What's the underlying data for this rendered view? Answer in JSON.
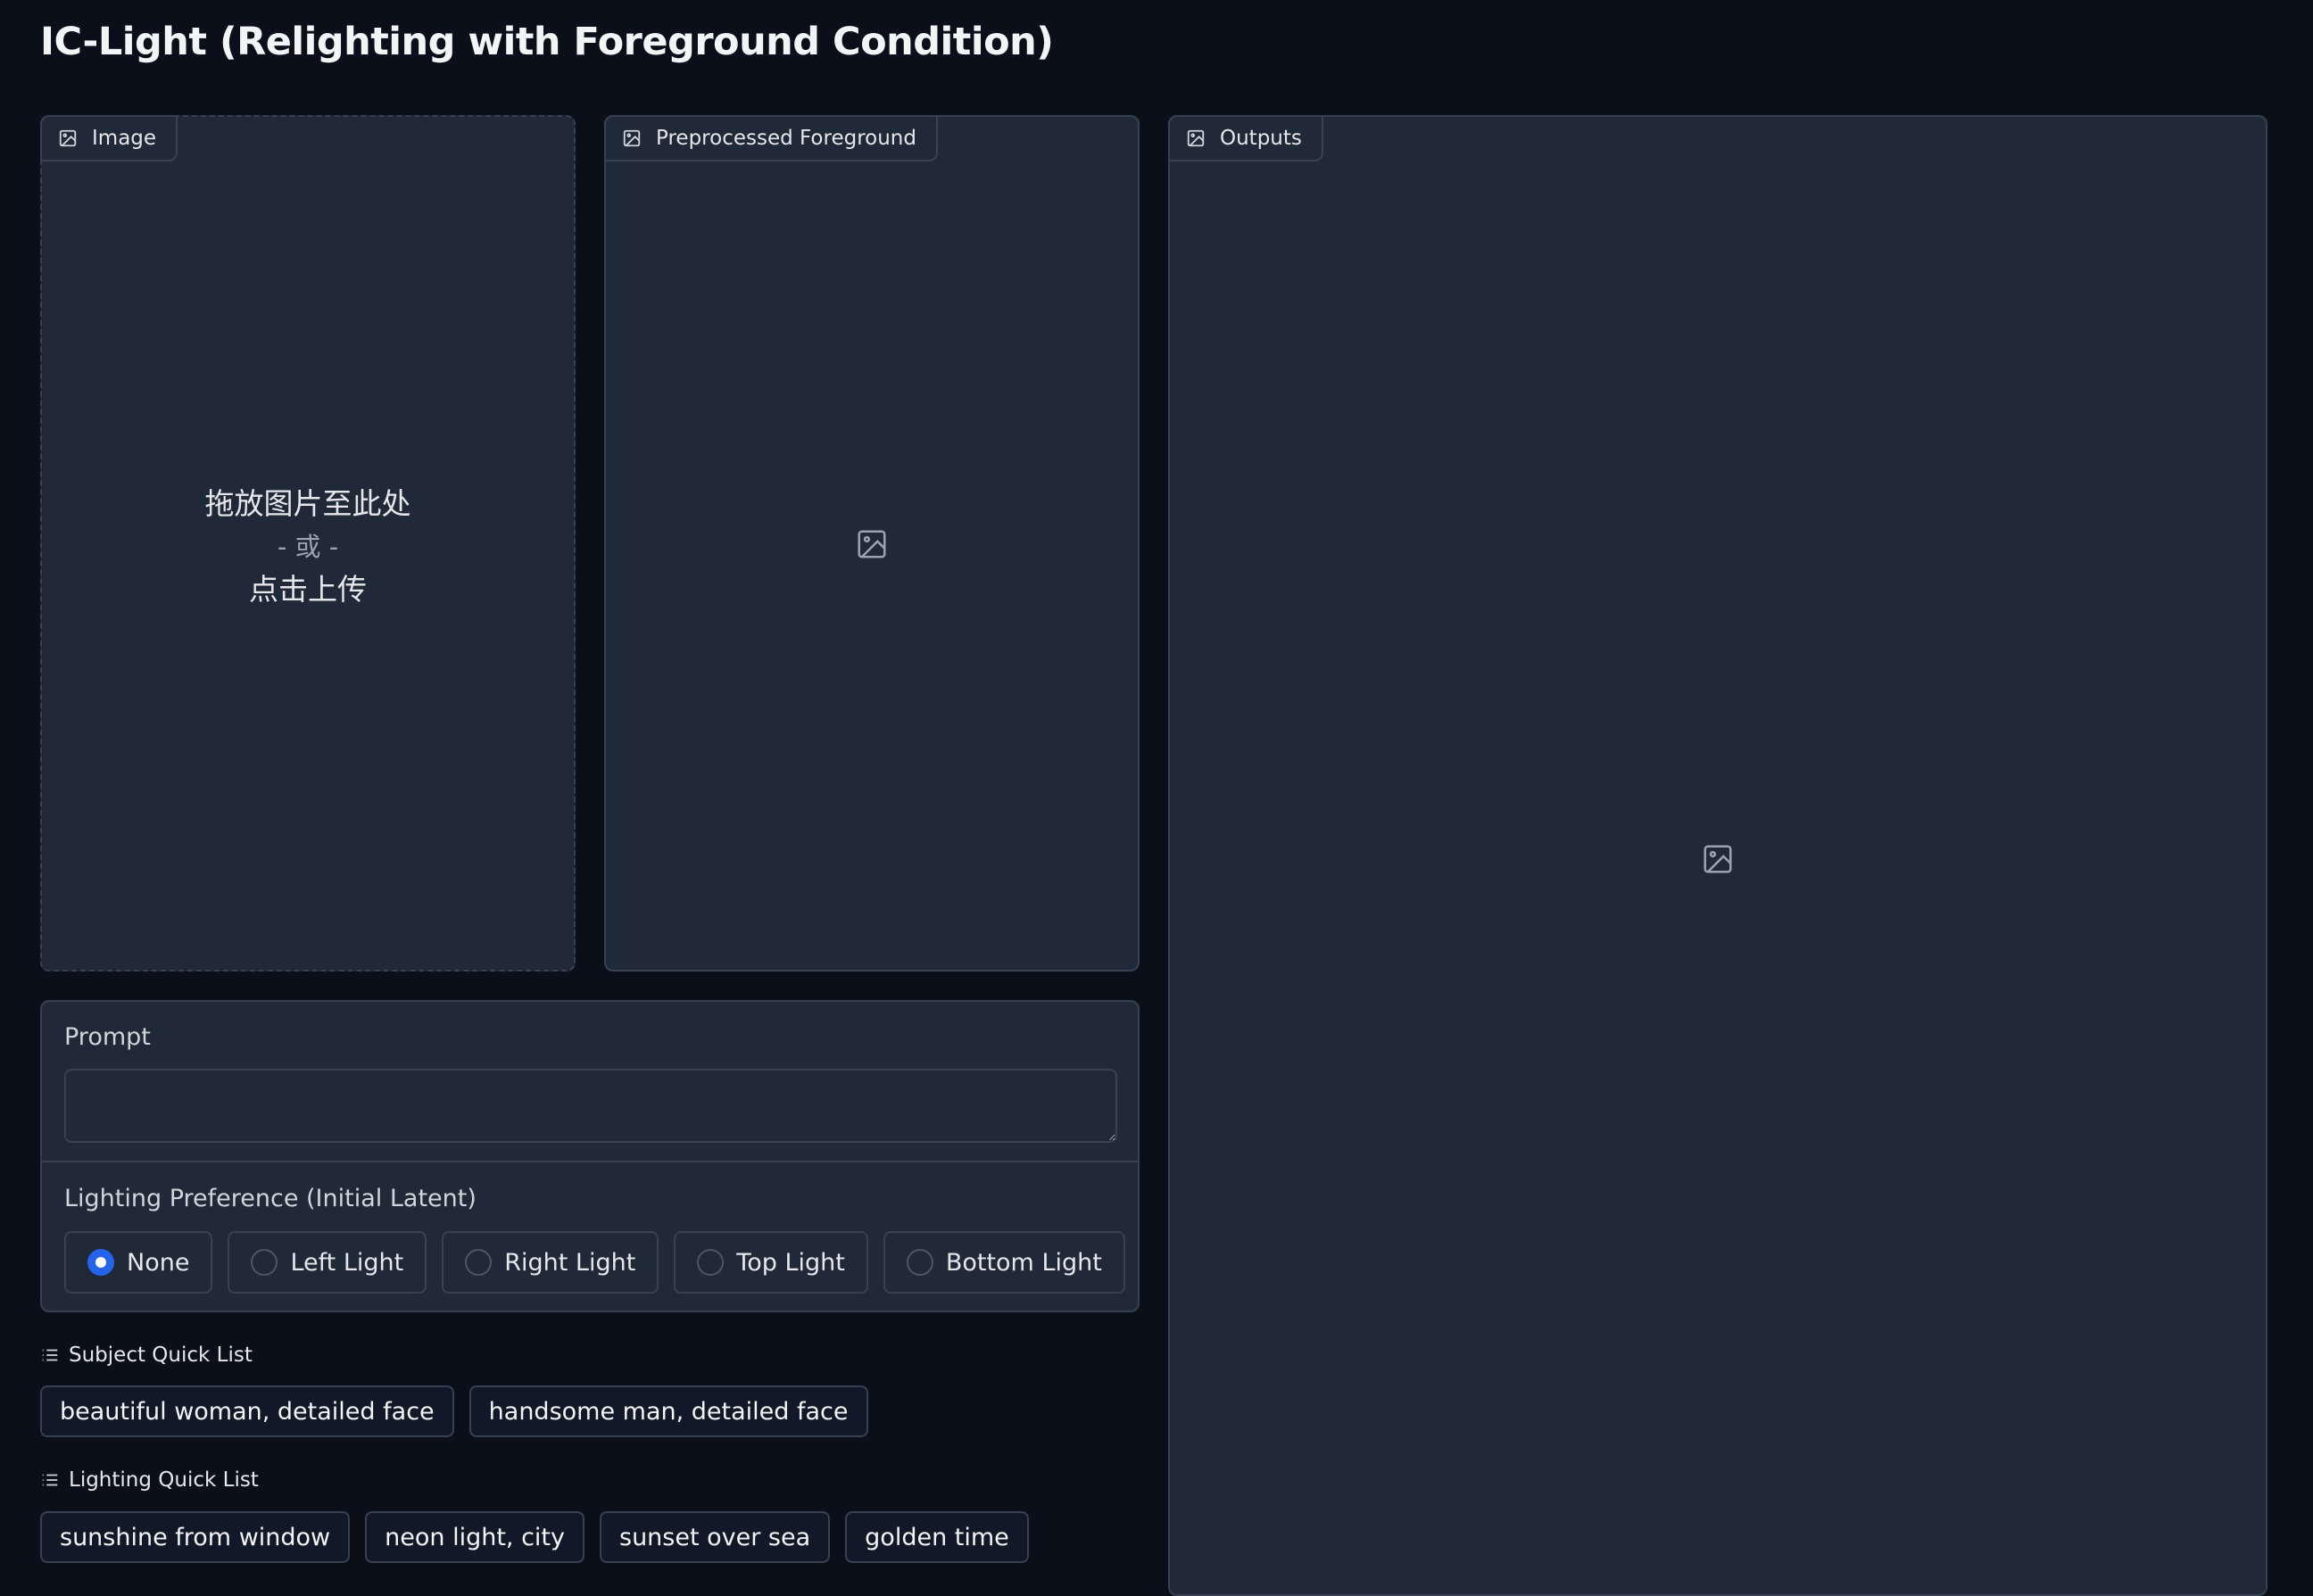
{
  "title": "IC-Light (Relighting with Foreground Condition)",
  "image_panel": {
    "label": "Image",
    "icon": "image-icon",
    "drop_text": "拖放图片至此处",
    "or_text": "- 或 -",
    "click_text": "点击上传"
  },
  "preprocessed_panel": {
    "label": "Preprocessed Foreground",
    "icon": "image-icon"
  },
  "outputs_panel": {
    "label": "Outputs",
    "icon": "image-icon"
  },
  "prompt": {
    "label": "Prompt",
    "value": ""
  },
  "lighting": {
    "label": "Lighting Preference (Initial Latent)",
    "selected": "None",
    "options": [
      "None",
      "Left Light",
      "Right Light",
      "Top Light",
      "Bottom Light"
    ]
  },
  "subject_quick_list": {
    "label": "Subject Quick List",
    "icon": "list-icon",
    "items": [
      "beautiful woman, detailed face",
      "handsome man, detailed face"
    ]
  },
  "lighting_quick_list": {
    "label": "Lighting Quick List",
    "icon": "list-icon",
    "items": [
      "sunshine from window",
      "neon light, city",
      "sunset over sea",
      "golden time"
    ]
  },
  "colors": {
    "background": "#0b0f19",
    "panel": "#1f2937",
    "border": "#374151",
    "accent": "#2563eb"
  }
}
